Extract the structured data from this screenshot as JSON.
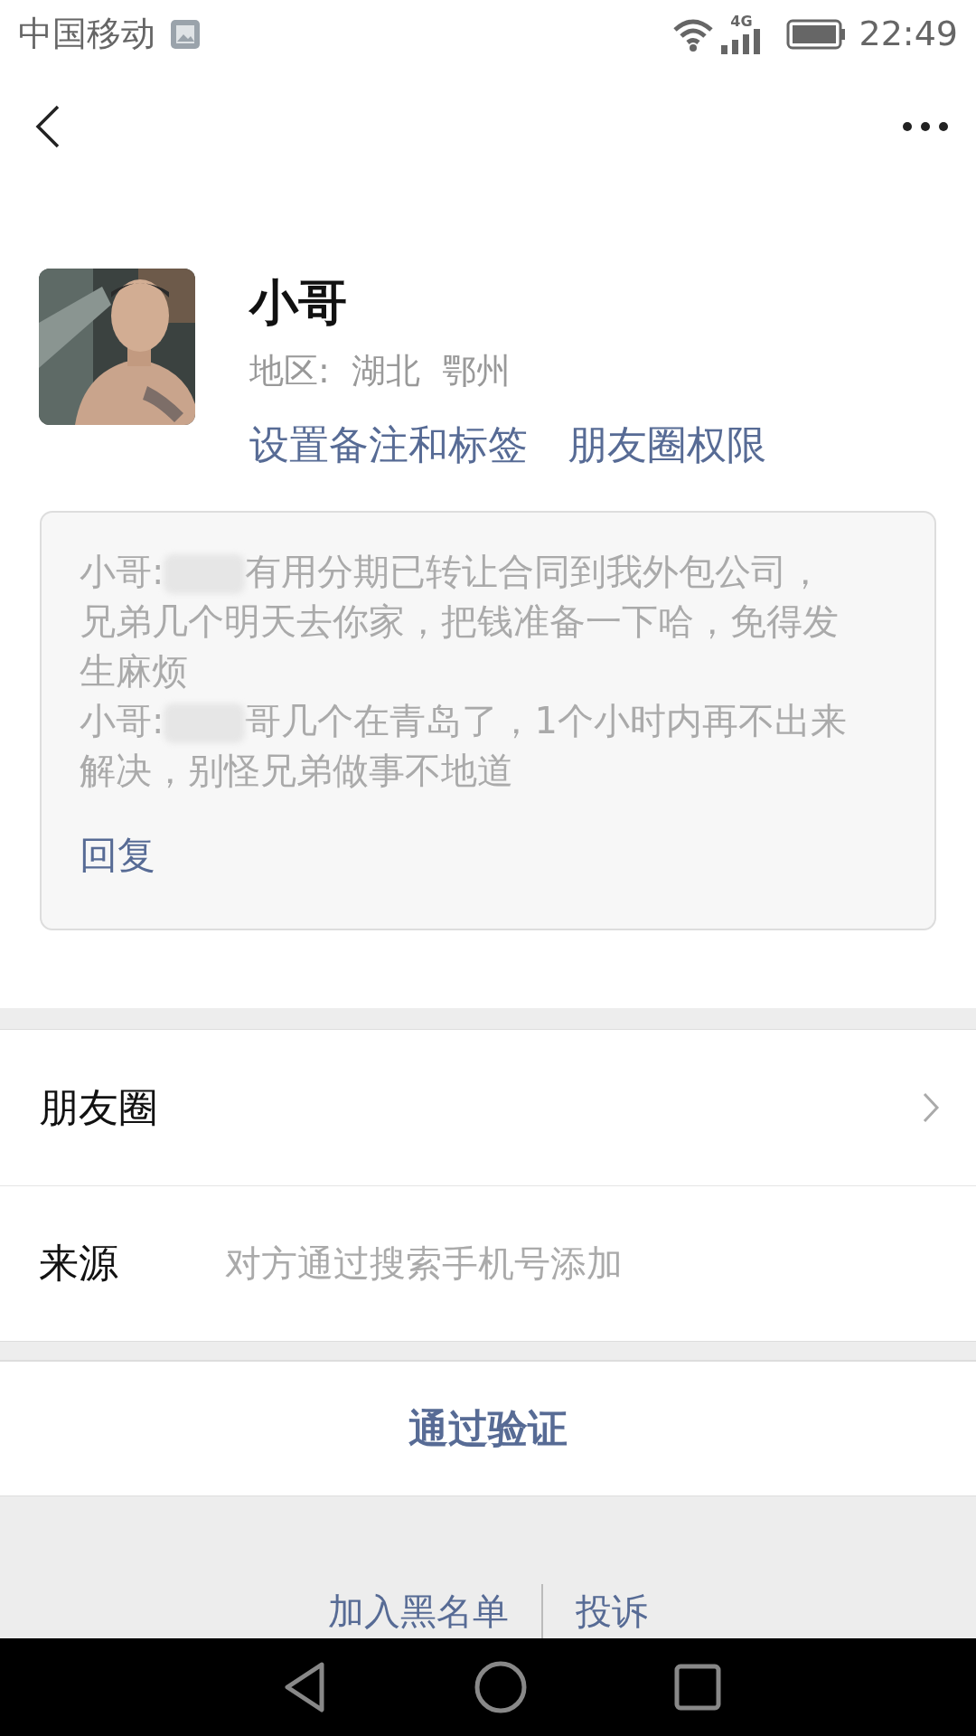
{
  "status_bar": {
    "carrier": "中国移动",
    "network": "4G",
    "time": "22:49"
  },
  "profile": {
    "kind": "picture",
    "name": "小哥",
    "region": "地区:  湖北  鄂州",
    "links": [
      "设置备注和标签",
      "朋友圈权限"
    ]
  },
  "messages": [
    {
      "sender": "小哥:",
      "text": "有用分期已转让合同到我外包公司，兄弟几个明天去你家，把钱准备一下哈，免得发生麻烦"
    },
    {
      "sender": "小哥:",
      "text": "哥几个在青岛了，1个小时内再不出来解决，别怪兄弟做事不地道"
    }
  ],
  "reply": "回复",
  "rows": [
    {
      "kind": "link",
      "label": "朋友圈"
    },
    {
      "kind": "info",
      "label": "来源",
      "value": "对方通过搜索手机号添加"
    }
  ],
  "action": "通过验证",
  "footer_links": [
    "加入黑名单",
    "投诉"
  ]
}
